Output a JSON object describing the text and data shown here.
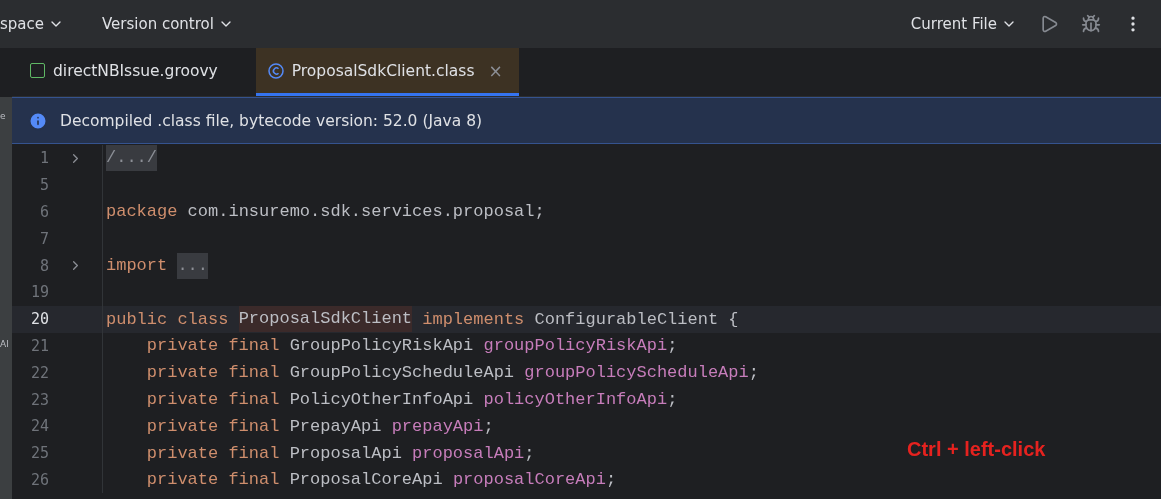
{
  "toolbar": {
    "menus": [
      {
        "label": "space"
      },
      {
        "label": "Version control"
      }
    ],
    "run_config": {
      "label": "Current File"
    }
  },
  "left_strip": {
    "labels": [
      "e",
      "Al"
    ]
  },
  "tabs": [
    {
      "label": "directNBIssue.groovy",
      "kind": "groovy",
      "selected": false
    },
    {
      "label": "ProposalSdkClient.class",
      "kind": "class",
      "selected": true,
      "close": "×"
    }
  ],
  "banner": {
    "text": "Decompiled .class file, bytecode version: 52.0 (Java 8)"
  },
  "editor": {
    "lines": [
      {
        "number": "1",
        "foldable": true,
        "current": false,
        "tokens": [
          {
            "kind": "folded",
            "text": "/.../"
          }
        ]
      },
      {
        "number": "5",
        "foldable": false,
        "current": false
      },
      {
        "number": "6",
        "foldable": false,
        "current": false,
        "tokens": [
          {
            "kind": "keyword",
            "text": "package"
          },
          {
            "kind": "text",
            "text": " com.insuremo.sdk.services.proposal;"
          }
        ]
      },
      {
        "number": "7",
        "foldable": false,
        "current": false
      },
      {
        "number": "8",
        "foldable": true,
        "current": false,
        "tokens": [
          {
            "kind": "keyword",
            "text": "import "
          },
          {
            "kind": "folded",
            "text": "..."
          }
        ]
      },
      {
        "number": "19",
        "foldable": false,
        "current": false
      },
      {
        "number": "20",
        "foldable": false,
        "current": true,
        "tokens": [
          {
            "kind": "keyword",
            "text": "public class "
          },
          {
            "kind": "highlighted",
            "text": "ProposalSdkClient"
          },
          {
            "kind": "keyword",
            "text": " implements"
          },
          {
            "kind": "text",
            "text": " ConfigurableClient {"
          }
        ]
      },
      {
        "number": "21",
        "foldable": false,
        "current": false,
        "tokens": [
          {
            "kind": "keyword",
            "text": "    private final"
          },
          {
            "kind": "text",
            "text": " GroupPolicyRiskApi "
          },
          {
            "kind": "field",
            "text": "groupPolicyRiskApi"
          },
          {
            "kind": "text",
            "text": ";"
          }
        ]
      },
      {
        "number": "22",
        "foldable": false,
        "current": false,
        "tokens": [
          {
            "kind": "keyword",
            "text": "    private final"
          },
          {
            "kind": "text",
            "text": " GroupPolicyScheduleApi "
          },
          {
            "kind": "field",
            "text": "groupPolicyScheduleApi"
          },
          {
            "kind": "text",
            "text": ";"
          }
        ]
      },
      {
        "number": "23",
        "foldable": false,
        "current": false,
        "tokens": [
          {
            "kind": "keyword",
            "text": "    private final"
          },
          {
            "kind": "text",
            "text": " PolicyOtherInfoApi "
          },
          {
            "kind": "field",
            "text": "policyOtherInfoApi"
          },
          {
            "kind": "text",
            "text": ";"
          }
        ]
      },
      {
        "number": "24",
        "foldable": false,
        "current": false,
        "tokens": [
          {
            "kind": "keyword",
            "text": "    private final"
          },
          {
            "kind": "text",
            "text": " PrepayApi "
          },
          {
            "kind": "field",
            "text": "prepayApi"
          },
          {
            "kind": "text",
            "text": ";"
          }
        ]
      },
      {
        "number": "25",
        "foldable": false,
        "current": false,
        "tokens": [
          {
            "kind": "keyword",
            "text": "    private final"
          },
          {
            "kind": "text",
            "text": " ProposalApi "
          },
          {
            "kind": "field",
            "text": "proposalApi"
          },
          {
            "kind": "text",
            "text": ";"
          }
        ]
      },
      {
        "number": "26",
        "foldable": false,
        "current": false,
        "tokens": [
          {
            "kind": "keyword",
            "text": "    private final"
          },
          {
            "kind": "text",
            "text": " ProposalCoreApi "
          },
          {
            "kind": "field",
            "text": "proposalCoreApi"
          },
          {
            "kind": "text",
            "text": ";"
          }
        ]
      }
    ]
  },
  "annotation": {
    "text": "Ctrl + left-click"
  }
}
